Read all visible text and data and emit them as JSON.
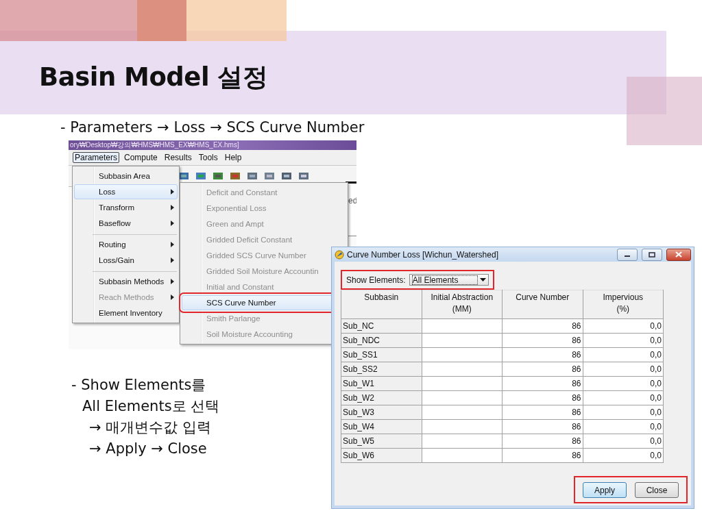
{
  "slide": {
    "title": "Basin Model 설정",
    "subtitle": "- Parameters → Loss → SCS Curve Number",
    "notes": [
      "- Show Elements를",
      "All Elements로 선택",
      "→ 매개변수값 입력",
      "→ Apply → Close"
    ]
  },
  "menu_screenshot": {
    "title_bar": "ory₩Desktop₩강의₩HMS₩HMS_EX₩HMS_EX.hms]",
    "menu_bar": [
      {
        "label": "Parameters",
        "selected": true
      },
      {
        "label": "Compute",
        "selected": false
      },
      {
        "label": "Results",
        "selected": false
      },
      {
        "label": "Tools",
        "selected": false
      },
      {
        "label": "Help",
        "selected": false
      }
    ],
    "background_text": "ed",
    "menu_items": [
      {
        "label": "Subbasin Area",
        "submenu": false,
        "disabled": false,
        "selected": false,
        "separator_before": false
      },
      {
        "label": "Loss",
        "submenu": true,
        "disabled": false,
        "selected": true,
        "separator_before": false
      },
      {
        "label": "Transform",
        "submenu": true,
        "disabled": false,
        "selected": false,
        "separator_before": false
      },
      {
        "label": "Baseflow",
        "submenu": true,
        "disabled": false,
        "selected": false,
        "separator_before": false
      },
      {
        "label": "Routing",
        "submenu": true,
        "disabled": false,
        "selected": false,
        "separator_before": true
      },
      {
        "label": "Loss/Gain",
        "submenu": true,
        "disabled": false,
        "selected": false,
        "separator_before": false
      },
      {
        "label": "Subbasin Methods",
        "submenu": true,
        "disabled": false,
        "selected": false,
        "separator_before": true
      },
      {
        "label": "Reach Methods",
        "submenu": true,
        "disabled": true,
        "selected": false,
        "separator_before": false
      },
      {
        "label": "Element Inventory",
        "submenu": false,
        "disabled": false,
        "selected": false,
        "separator_before": false
      }
    ],
    "submenu_items": [
      {
        "label": "Deficit and Constant",
        "disabled": true,
        "selected": false,
        "highlighted": false
      },
      {
        "label": "Exponential Loss",
        "disabled": true,
        "selected": false,
        "highlighted": false
      },
      {
        "label": "Green and Ampt",
        "disabled": true,
        "selected": false,
        "highlighted": false
      },
      {
        "label": "Gridded Deficit Constant",
        "disabled": true,
        "selected": false,
        "highlighted": false
      },
      {
        "label": "Gridded SCS Curve Number",
        "disabled": true,
        "selected": false,
        "highlighted": false
      },
      {
        "label": "Gridded Soil Moisture Accountin",
        "disabled": true,
        "selected": false,
        "highlighted": false
      },
      {
        "label": "Initial and Constant",
        "disabled": true,
        "selected": false,
        "highlighted": false
      },
      {
        "label": "SCS Curve Number",
        "disabled": false,
        "selected": true,
        "highlighted": true
      },
      {
        "label": "Smith Parlange",
        "disabled": true,
        "selected": false,
        "highlighted": false
      },
      {
        "label": "Soil Moisture Accounting",
        "disabled": true,
        "selected": false,
        "highlighted": false
      }
    ]
  },
  "dialog": {
    "title": "Curve Number Loss [Wichun_Watershed]",
    "show_elements": {
      "label": "Show Elements:",
      "value": "All Elements",
      "highlighted": true
    },
    "columns": [
      "Subbasin",
      "Initial Abstraction\n(MM)",
      "Curve Number",
      "Impervious\n(%)"
    ],
    "rows": [
      {
        "subbasin": "Sub_NC",
        "curve_number": "86",
        "impervious": "0,0"
      },
      {
        "subbasin": "Sub_NDC",
        "curve_number": "86",
        "impervious": "0,0"
      },
      {
        "subbasin": "Sub_SS1",
        "curve_number": "86",
        "impervious": "0,0"
      },
      {
        "subbasin": "Sub_SS2",
        "curve_number": "86",
        "impervious": "0,0"
      },
      {
        "subbasin": "Sub_W1",
        "curve_number": "86",
        "impervious": "0,0"
      },
      {
        "subbasin": "Sub_W2",
        "curve_number": "86",
        "impervious": "0,0"
      },
      {
        "subbasin": "Sub_W3",
        "curve_number": "86",
        "impervious": "0,0"
      },
      {
        "subbasin": "Sub_W4",
        "curve_number": "86",
        "impervious": "0,0"
      },
      {
        "subbasin": "Sub_W5",
        "curve_number": "86",
        "impervious": "0,0"
      },
      {
        "subbasin": "Sub_W6",
        "curve_number": "86",
        "impervious": "0,0"
      }
    ],
    "buttons_highlighted": true,
    "buttons": [
      {
        "label": "Apply",
        "kind": "default"
      },
      {
        "label": "Close",
        "kind": "normal"
      }
    ]
  }
}
